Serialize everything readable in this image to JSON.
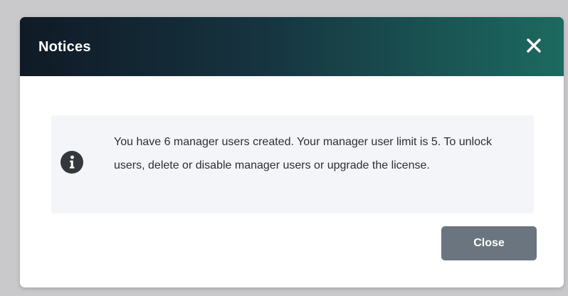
{
  "dialog": {
    "title": "Notices",
    "message": "You have 6 manager users created. Your manager user limit is 5. To unlock users, delete or disable manager users or upgrade the license.",
    "close_button_label": "Close",
    "icons": {
      "close": "close-icon",
      "info": "info-icon"
    }
  },
  "colors": {
    "backdrop": "#c9c9cb",
    "header_gradient_start": "#0f1a26",
    "header_gradient_end": "#1c6a60",
    "notice_background": "#f4f5f9",
    "button_background": "#6b757f"
  }
}
